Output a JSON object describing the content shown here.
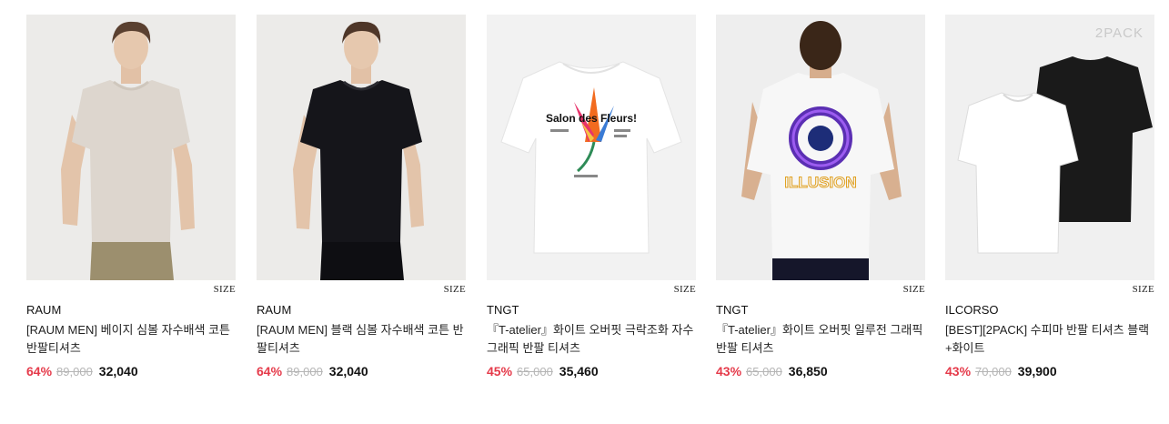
{
  "products": [
    {
      "brand": "RAUM",
      "name": "[RAUM MEN] 베이지 심볼 자수배색 코튼 반팔티셔츠",
      "discount": "64%",
      "original_price": "89,000",
      "price": "32,040",
      "size_label": "SIZE",
      "shirt_color": "#ddd6ce",
      "pack_label": ""
    },
    {
      "brand": "RAUM",
      "name": "[RAUM MEN] 블랙 심볼 자수배색 코튼 반팔티셔츠",
      "discount": "64%",
      "original_price": "89,000",
      "price": "32,040",
      "size_label": "SIZE",
      "shirt_color": "#15151a",
      "pack_label": ""
    },
    {
      "brand": "TNGT",
      "name": "『T-atelier』화이트 오버핏 극락조화 자수 그래픽 반팔 티셔츠",
      "discount": "45%",
      "original_price": "65,000",
      "price": "35,460",
      "size_label": "SIZE",
      "shirt_color": "#ffffff",
      "pack_label": "",
      "graphic_text": "Salon des Fleurs!"
    },
    {
      "brand": "TNGT",
      "name": "『T-atelier』화이트 오버핏 일루전 그래픽 반팔 티셔츠",
      "discount": "43%",
      "original_price": "65,000",
      "price": "36,850",
      "size_label": "SIZE",
      "shirt_color": "#f7f7f7",
      "pack_label": "",
      "graphic_text": "ILLUSION"
    },
    {
      "brand": "ILCORSO",
      "name": "[BEST][2PACK] 수피마 반팔 티셔츠 블랙+화이트",
      "discount": "43%",
      "original_price": "70,000",
      "price": "39,900",
      "size_label": "SIZE",
      "shirt_color": "#ffffff",
      "pack_label": "2PACK"
    }
  ]
}
